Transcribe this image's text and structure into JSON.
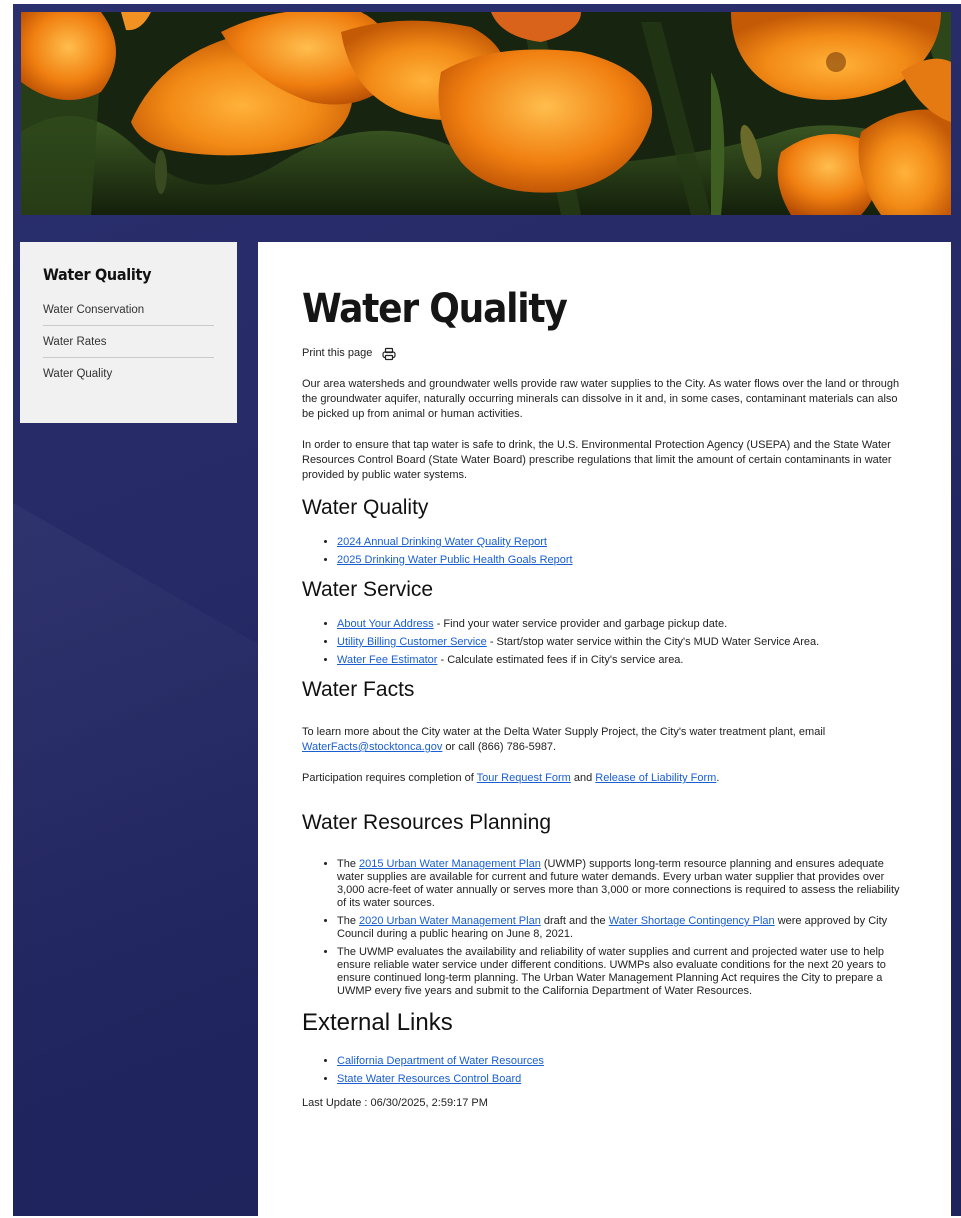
{
  "sidebar": {
    "title": "Water Quality",
    "items": [
      {
        "label": "Water Conservation"
      },
      {
        "label": "Water Rates"
      },
      {
        "label": "Water Quality"
      }
    ]
  },
  "main": {
    "title": "Water Quality",
    "print_label": "Print this page",
    "intro_1": "Our area watersheds and groundwater wells provide raw water supplies to the City. As water flows over the land or through the groundwater aquifer, naturally occurring minerals can dissolve in it and, in some cases, contaminant materials can also be picked up from animal or human activities.",
    "intro_2": "In order to ensure that tap water is safe to drink, the U.S. Environmental Protection Agency (USEPA) and the State Water Resources Control Board (State Water Board) prescribe regulations that limit the amount of certain contaminants in water provided by public water systems.",
    "quality": {
      "heading": "Water Quality",
      "links": [
        {
          "text": "2024 Annual Drinking Water Quality Report"
        },
        {
          "text": "2025 Drinking Water Public Health Goals Report"
        }
      ]
    },
    "service": {
      "heading": "Water Service",
      "items": [
        {
          "link": "About Your Address",
          "desc": " - Find your water service provider and garbage pickup date."
        },
        {
          "link": "Utility Billing Customer Service",
          "desc": " - Start/stop water service within the City's MUD Water Service Area."
        },
        {
          "link": "Water Fee Estimator",
          "desc": " - Calculate estimated fees if in City's service area."
        }
      ]
    },
    "facts": {
      "heading": "Water Facts",
      "text_before": "To learn more about the City water at the Delta Water Supply Project, the City's water treatment plant, email ",
      "email": "WaterFacts@stocktonca.gov",
      "text_after": " or call (866) 786-5987.",
      "participation_before": "Participation requires completion of ",
      "tour_link": "Tour Request Form",
      "participation_mid": " and ",
      "release_link": "Release of Liability Form",
      "participation_after": "."
    },
    "planning": {
      "heading": "Water Resources Planning",
      "item1_before": "The ",
      "item1_link": "2015 Urban Water Management Plan",
      "item1_after": " (UWMP) supports long-term resource planning and ensures adequate water supplies are available for current and future water demands. Every urban water supplier that provides over 3,000 acre-feet of water annually or serves more than 3,000 or more connections is required to assess the reliability of its water sources.",
      "item2_before": "The ",
      "item2_link": "2020 Urban Water Management Plan",
      "item2_mid": " draft and the ",
      "item2_link2": "Water Shortage Contingency Plan",
      "item2_after": " were approved by City Council during a public hearing on June 8, 2021.",
      "item3": "The UWMP evaluates the availability and reliability of water supplies and current and projected water use to help ensure reliable water service under different conditions. UWMPs also evaluate conditions for the next 20 years to ensure continued long-term planning. The Urban Water Management Planning Act requires the City to prepare a UWMP every five years and submit to the California Department of Water Resources."
    },
    "external": {
      "heading": "External Links",
      "links": [
        {
          "text": "California Department of Water Resources"
        },
        {
          "text": "State Water Resources Control Board"
        }
      ]
    },
    "last_update": "Last Update : 06/30/2025, 2:59:17 PM"
  },
  "icons": {
    "printer": "printer-icon"
  },
  "colors": {
    "background": "#262a66",
    "link": "#1a5fd1",
    "poppy": "#f28a16"
  }
}
